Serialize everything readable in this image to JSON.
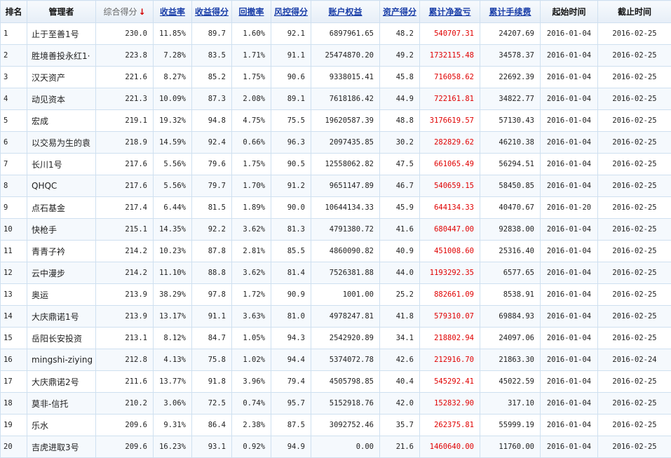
{
  "headers": [
    {
      "label": "排名"
    },
    {
      "label": "管理者"
    },
    {
      "label": "综合得分",
      "sort_arrow": "↓"
    },
    {
      "label": "收益率"
    },
    {
      "label": "收益得分"
    },
    {
      "label": "回撤率"
    },
    {
      "label": "风控得分"
    },
    {
      "label": "账户权益"
    },
    {
      "label": "资产得分"
    },
    {
      "label": "累计净盈亏"
    },
    {
      "label": "累计手续费"
    },
    {
      "label": "起始时间"
    },
    {
      "label": "截止时间"
    }
  ],
  "rows": [
    [
      "1",
      "止于至善1号",
      "230.0",
      "11.85%",
      "89.7",
      "1.60%",
      "92.1",
      "6897961.65",
      "48.2",
      "540707.31",
      "24207.69",
      "2016-01-04",
      "2016-02-25"
    ],
    [
      "2",
      "胜境善投永红1·",
      "223.8",
      "7.28%",
      "83.5",
      "1.71%",
      "91.1",
      "25474870.20",
      "49.2",
      "1732115.48",
      "34578.37",
      "2016-01-04",
      "2016-02-25"
    ],
    [
      "3",
      "汉天资产",
      "221.6",
      "8.27%",
      "85.2",
      "1.75%",
      "90.6",
      "9338015.41",
      "45.8",
      "716058.62",
      "22692.39",
      "2016-01-04",
      "2016-02-25"
    ],
    [
      "4",
      "动见资本",
      "221.3",
      "10.09%",
      "87.3",
      "2.08%",
      "89.1",
      "7618186.42",
      "44.9",
      "722161.81",
      "34822.77",
      "2016-01-04",
      "2016-02-25"
    ],
    [
      "5",
      "宏成",
      "219.1",
      "19.32%",
      "94.8",
      "4.75%",
      "75.5",
      "19620587.39",
      "48.8",
      "3176619.57",
      "57130.43",
      "2016-01-04",
      "2016-02-25"
    ],
    [
      "6",
      "以交易为生的袁",
      "218.9",
      "14.59%",
      "92.4",
      "0.66%",
      "96.3",
      "2097435.85",
      "30.2",
      "282829.62",
      "46210.38",
      "2016-01-04",
      "2016-02-25"
    ],
    [
      "7",
      "长川1号",
      "217.6",
      "5.56%",
      "79.6",
      "1.75%",
      "90.5",
      "12558062.82",
      "47.5",
      "661065.49",
      "56294.51",
      "2016-01-04",
      "2016-02-25"
    ],
    [
      "8",
      "QHQC",
      "217.6",
      "5.56%",
      "79.7",
      "1.70%",
      "91.2",
      "9651147.89",
      "46.7",
      "540659.15",
      "58450.85",
      "2016-01-04",
      "2016-02-25"
    ],
    [
      "9",
      "点石基金",
      "217.4",
      "6.44%",
      "81.5",
      "1.89%",
      "90.0",
      "10644134.33",
      "45.9",
      "644134.33",
      "40470.67",
      "2016-01-20",
      "2016-02-25"
    ],
    [
      "10",
      "快枪手",
      "215.1",
      "14.35%",
      "92.2",
      "3.62%",
      "81.3",
      "4791380.72",
      "41.6",
      "680447.00",
      "92838.00",
      "2016-01-04",
      "2016-02-25"
    ],
    [
      "11",
      "青青子衿",
      "214.2",
      "10.23%",
      "87.8",
      "2.81%",
      "85.5",
      "4860090.82",
      "40.9",
      "451008.60",
      "25316.40",
      "2016-01-04",
      "2016-02-25"
    ],
    [
      "12",
      "云中漫步",
      "214.2",
      "11.10%",
      "88.8",
      "3.62%",
      "81.4",
      "7526381.88",
      "44.0",
      "1193292.35",
      "6577.65",
      "2016-01-04",
      "2016-02-25"
    ],
    [
      "13",
      "奥运",
      "213.9",
      "38.29%",
      "97.8",
      "1.72%",
      "90.9",
      "1001.00",
      "25.2",
      "882661.09",
      "8538.91",
      "2016-01-04",
      "2016-02-25"
    ],
    [
      "14",
      "大庆鼎诺1号",
      "213.9",
      "13.17%",
      "91.1",
      "3.63%",
      "81.0",
      "4978247.81",
      "41.8",
      "579310.07",
      "69884.93",
      "2016-01-04",
      "2016-02-25"
    ],
    [
      "15",
      "岳阳长安投资",
      "213.1",
      "8.12%",
      "84.7",
      "1.05%",
      "94.3",
      "2542920.89",
      "34.1",
      "218802.94",
      "24097.06",
      "2016-01-04",
      "2016-02-25"
    ],
    [
      "16",
      "mingshi-ziying",
      "212.8",
      "4.13%",
      "75.8",
      "1.02%",
      "94.4",
      "5374072.78",
      "42.6",
      "212916.70",
      "21863.30",
      "2016-01-04",
      "2016-02-24"
    ],
    [
      "17",
      "大庆鼎诺2号",
      "211.6",
      "13.77%",
      "91.8",
      "3.96%",
      "79.4",
      "4505798.85",
      "40.4",
      "545292.41",
      "45022.59",
      "2016-01-04",
      "2016-02-25"
    ],
    [
      "18",
      "莫非-信托",
      "210.2",
      "3.06%",
      "72.5",
      "0.74%",
      "95.7",
      "5152918.76",
      "42.0",
      "152832.90",
      "317.10",
      "2016-01-04",
      "2016-02-25"
    ],
    [
      "19",
      "乐水",
      "209.6",
      "9.31%",
      "86.4",
      "2.38%",
      "87.5",
      "3092752.46",
      "35.7",
      "262375.81",
      "55999.19",
      "2016-01-04",
      "2016-02-25"
    ],
    [
      "20",
      "吉虎进取3号",
      "209.6",
      "16.23%",
      "93.1",
      "0.92%",
      "94.9",
      "0.00",
      "21.6",
      "1460640.00",
      "11760.00",
      "2016-01-04",
      "2016-02-25"
    ]
  ]
}
